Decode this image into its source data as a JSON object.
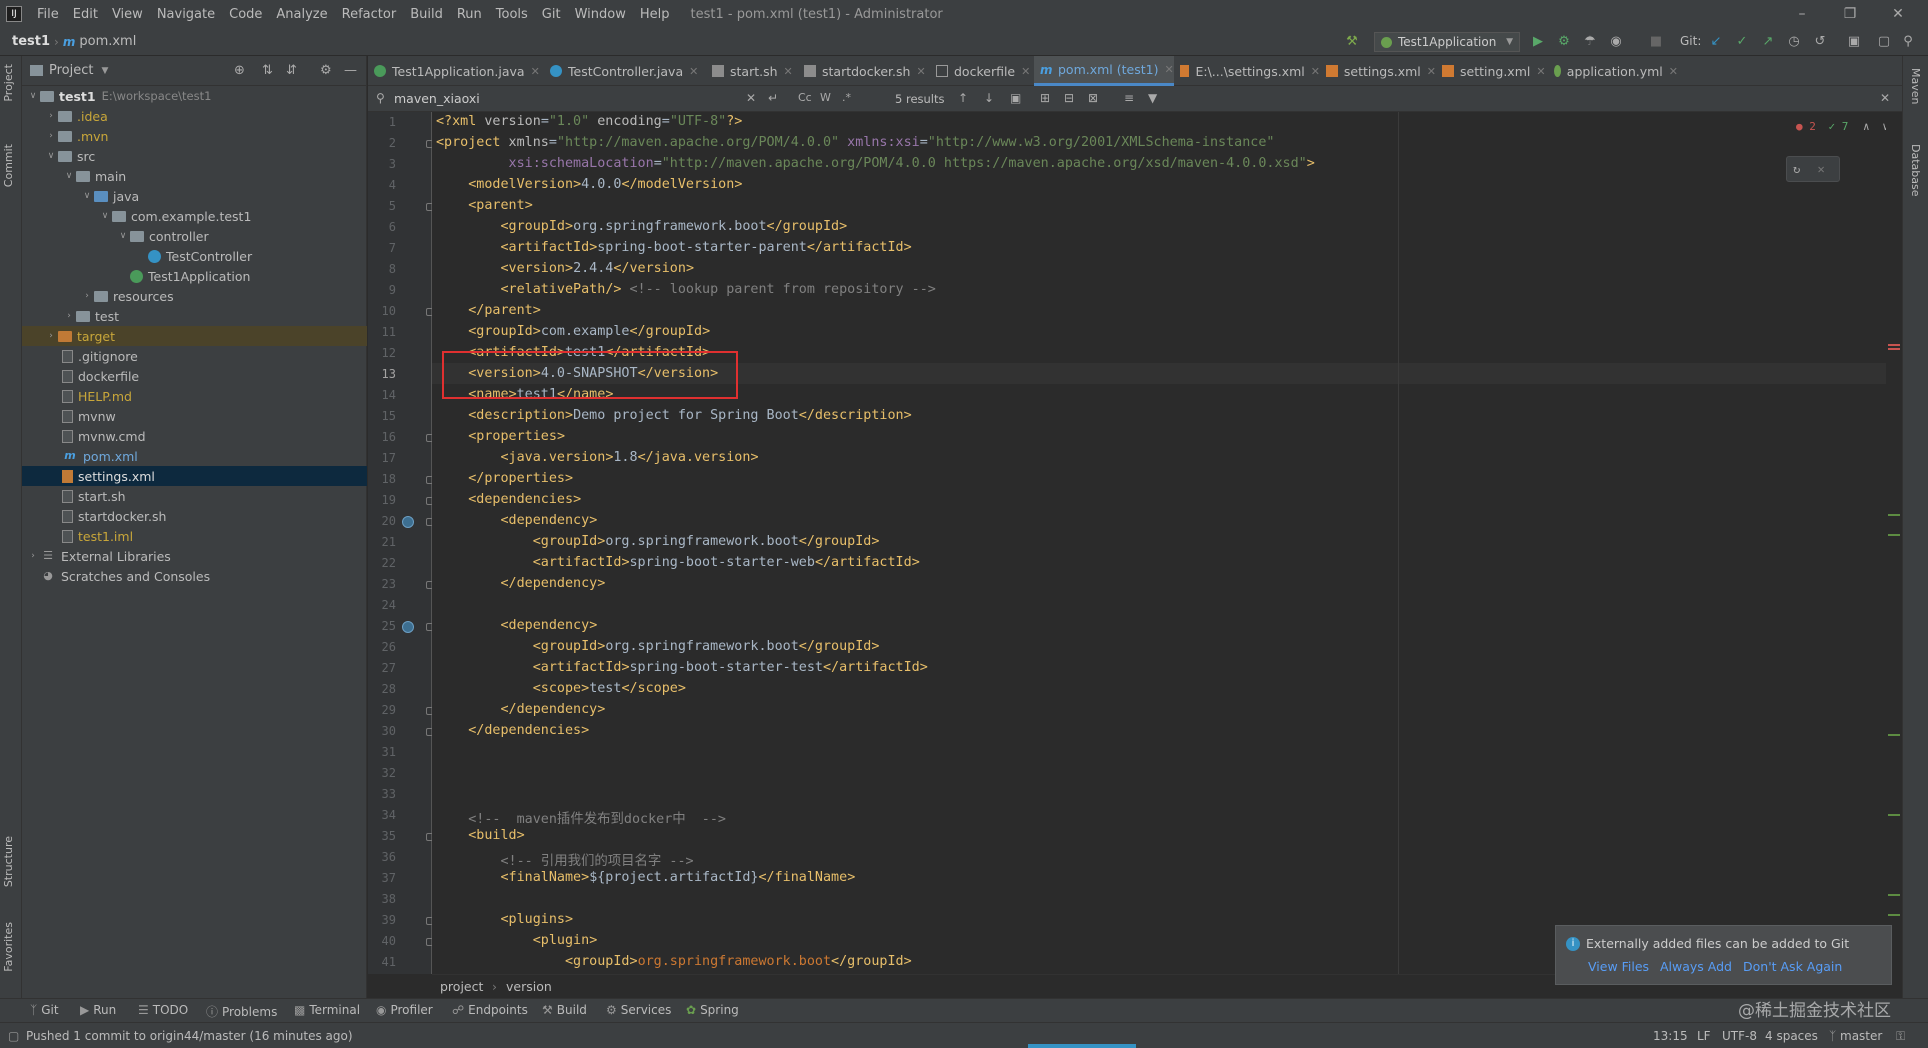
{
  "menubar": {
    "items": [
      "File",
      "Edit",
      "View",
      "Navigate",
      "Code",
      "Analyze",
      "Refactor",
      "Build",
      "Run",
      "Tools",
      "Git",
      "Window",
      "Help"
    ],
    "window_title": "test1 - pom.xml (test1) - Administrator"
  },
  "navbar": {
    "project": "test1",
    "file": "pom.xml",
    "run_config": "Test1Application",
    "git_label": "Git:"
  },
  "project_panel": {
    "title": "Project",
    "tree": [
      {
        "label": "test1",
        "extra": "E:\\workspace\\test1"
      },
      {
        "label": ".idea"
      },
      {
        "label": ".mvn"
      },
      {
        "label": "src"
      },
      {
        "label": "main"
      },
      {
        "label": "java"
      },
      {
        "label": "com.example.test1"
      },
      {
        "label": "controller"
      },
      {
        "label": "TestController"
      },
      {
        "label": "Test1Application"
      },
      {
        "label": "resources"
      },
      {
        "label": "test"
      },
      {
        "label": "target"
      },
      {
        "label": ".gitignore"
      },
      {
        "label": "dockerfile"
      },
      {
        "label": "HELP.md"
      },
      {
        "label": "mvnw"
      },
      {
        "label": "mvnw.cmd"
      },
      {
        "label": "pom.xml"
      },
      {
        "label": "settings.xml"
      },
      {
        "label": "start.sh"
      },
      {
        "label": "startdocker.sh"
      },
      {
        "label": "test1.iml"
      },
      {
        "label": "External Libraries"
      },
      {
        "label": "Scratches and Consoles"
      }
    ]
  },
  "tabs": [
    "Test1Application.java",
    "TestController.java",
    "start.sh",
    "startdocker.sh",
    "dockerfile",
    "pom.xml (test1)",
    "E:\\...\\settings.xml",
    "settings.xml",
    "setting.xml",
    "application.yml"
  ],
  "search": {
    "query": "maven_xiaoxi",
    "results": "5 results"
  },
  "editor": {
    "inspections_errors": "2",
    "inspections_ok": "7",
    "current_line": 13,
    "line_numbers": [
      "1",
      "2",
      "3",
      "4",
      "5",
      "6",
      "7",
      "8",
      "9",
      "10",
      "11",
      "12",
      "13",
      "14",
      "15",
      "16",
      "17",
      "18",
      "19",
      "20",
      "21",
      "22",
      "23",
      "24",
      "25",
      "26",
      "27",
      "28",
      "29",
      "30",
      "31",
      "32",
      "33",
      "34",
      "35",
      "36",
      "37",
      "38",
      "39",
      "40",
      "41"
    ],
    "lines": [
      "<?xml version=\"1.0\" encoding=\"UTF-8\"?>",
      "<project xmlns=\"http://maven.apache.org/POM/4.0.0\" xmlns:xsi=\"http://www.w3.org/2001/XMLSchema-instance\"",
      "         xsi:schemaLocation=\"http://maven.apache.org/POM/4.0.0 https://maven.apache.org/xsd/maven-4.0.0.xsd\">",
      "    <modelVersion>4.0.0</modelVersion>",
      "    <parent>",
      "        <groupId>org.springframework.boot</groupId>",
      "        <artifactId>spring-boot-starter-parent</artifactId>",
      "        <version>2.4.4</version>",
      "        <relativePath/> <!-- lookup parent from repository -->",
      "    </parent>",
      "    <groupId>com.example</groupId>",
      "    <artifactId>test1</artifactId>",
      "    <version>4.0-SNAPSHOT</version>",
      "    <name>test1</name>",
      "    <description>Demo project for Spring Boot</description>",
      "    <properties>",
      "        <java.version>1.8</java.version>",
      "    </properties>",
      "    <dependencies>",
      "        <dependency>",
      "            <groupId>org.springframework.boot</groupId>",
      "            <artifactId>spring-boot-starter-web</artifactId>",
      "        </dependency>",
      "",
      "        <dependency>",
      "            <groupId>org.springframework.boot</groupId>",
      "            <artifactId>spring-boot-starter-test</artifactId>",
      "            <scope>test</scope>",
      "        </dependency>",
      "    </dependencies>",
      "",
      "",
      "",
      "    <!--  maven插件发布到docker中  -->",
      "    <build>",
      "        <!-- 引用我们的项目名字 -->",
      "        <finalName>${project.artifactId}</finalName>",
      "",
      "        <plugins>",
      "            <plugin>",
      "                <groupId>org.springframework.boot</groupId>"
    ]
  },
  "breadcrumb": {
    "a": "project",
    "b": "version"
  },
  "notification": {
    "message": "Externally added files can be added to Git",
    "actions": [
      "View Files",
      "Always Add",
      "Don't Ask Again"
    ]
  },
  "tool_windows": [
    "Git",
    "Run",
    "TODO",
    "Problems",
    "Terminal",
    "Profiler",
    "Endpoints",
    "Build",
    "Services",
    "Spring"
  ],
  "left_strip": [
    "Project",
    "Commit",
    "Structure",
    "Favorites"
  ],
  "right_strip": [
    "Maven",
    "Database"
  ],
  "status": {
    "message": "Pushed 1 commit to origin44/master (16 minutes ago)",
    "position": "13:15",
    "line_sep": "LF",
    "encoding": "UTF-8",
    "indent": "4 spaces",
    "branch": "master"
  },
  "watermark": "@稀土掘金技术社区",
  "colors": {
    "accent": "#4a88c7",
    "highlight_box": "#e03030"
  }
}
